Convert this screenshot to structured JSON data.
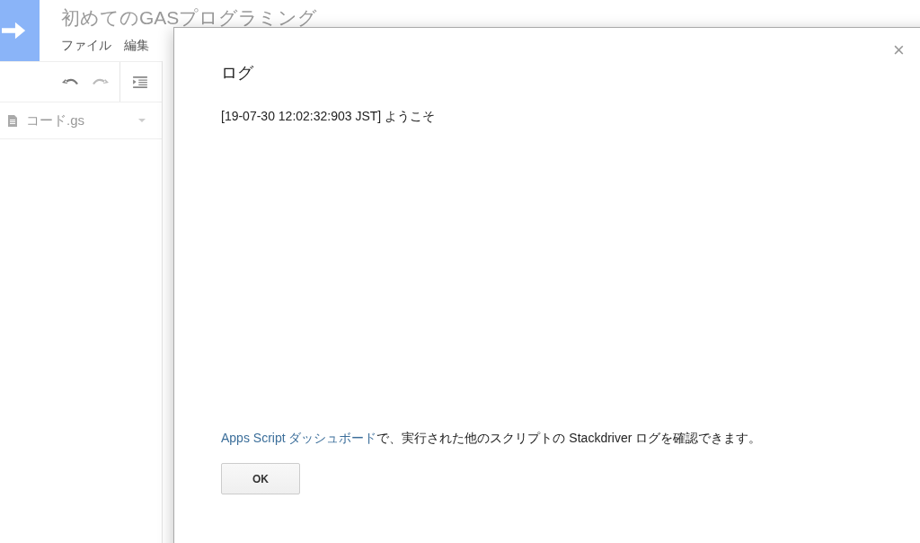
{
  "project": {
    "title": "初めてのGASプログラミング"
  },
  "menu": [
    "ファイル",
    "編集"
  ],
  "files": [
    {
      "name": "コード.gs"
    }
  ],
  "dialog": {
    "title": "ログ",
    "close": "×",
    "log": [
      "[19-07-30 12:02:32:903 JST] ようこそ"
    ],
    "note": {
      "link": "Apps Script ダッシュボード",
      "text": "で、実行された他のスクリプトの Stackdriver ログを確認できます。"
    },
    "buttons": [
      "OK"
    ]
  }
}
